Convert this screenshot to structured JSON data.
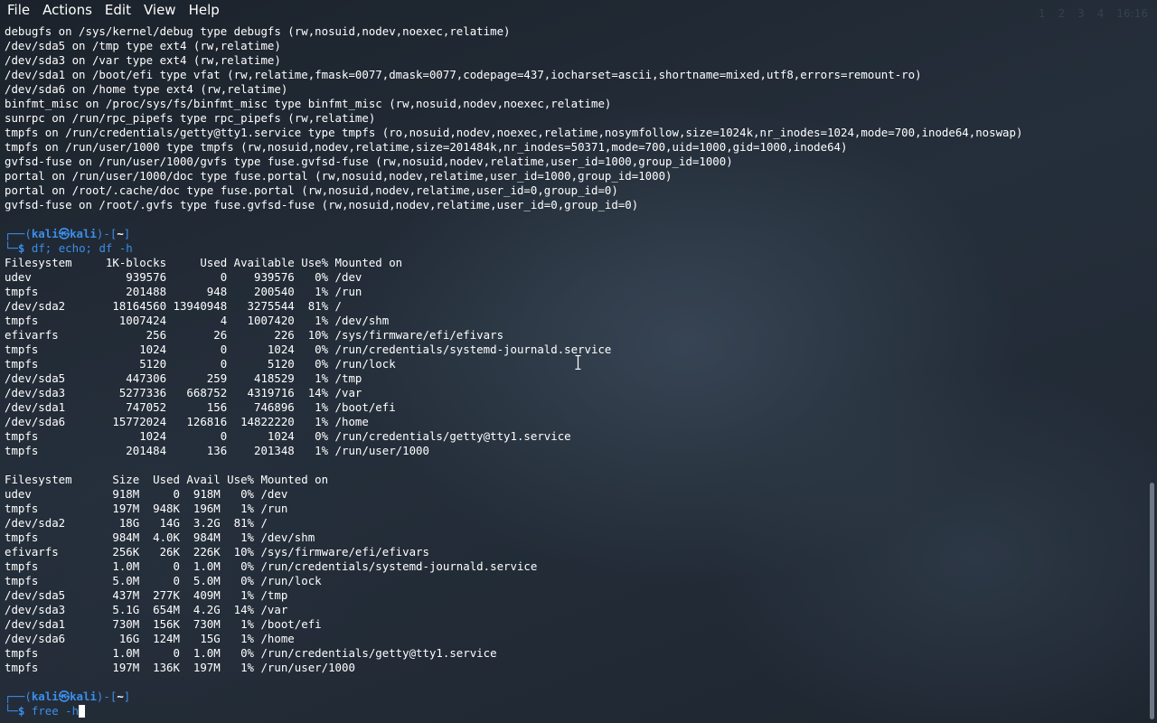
{
  "menubar": {
    "items": [
      "File",
      "Actions",
      "Edit",
      "View",
      "Help"
    ]
  },
  "tray": {
    "clock": "16:16",
    "workspaces": [
      "1",
      "2",
      "3",
      "4"
    ]
  },
  "terminal": {
    "mount_output": [
      "debugfs on /sys/kernel/debug type debugfs (rw,nosuid,nodev,noexec,relatime)",
      "/dev/sda5 on /tmp type ext4 (rw,relatime)",
      "/dev/sda3 on /var type ext4 (rw,relatime)",
      "/dev/sda1 on /boot/efi type vfat (rw,relatime,fmask=0077,dmask=0077,codepage=437,iocharset=ascii,shortname=mixed,utf8,errors=remount-ro)",
      "/dev/sda6 on /home type ext4 (rw,relatime)",
      "binfmt_misc on /proc/sys/fs/binfmt_misc type binfmt_misc (rw,nosuid,nodev,noexec,relatime)",
      "sunrpc on /run/rpc_pipefs type rpc_pipefs (rw,relatime)",
      "tmpfs on /run/credentials/getty@tty1.service type tmpfs (ro,nosuid,nodev,noexec,relatime,nosymfollow,size=1024k,nr_inodes=1024,mode=700,inode64,noswap)",
      "tmpfs on /run/user/1000 type tmpfs (rw,nosuid,nodev,relatime,size=201484k,nr_inodes=50371,mode=700,uid=1000,gid=1000,inode64)",
      "gvfsd-fuse on /run/user/1000/gvfs type fuse.gvfsd-fuse (rw,nosuid,nodev,relatime,user_id=1000,group_id=1000)",
      "portal on /run/user/1000/doc type fuse.portal (rw,nosuid,nodev,relatime,user_id=1000,group_id=1000)",
      "portal on /root/.cache/doc type fuse.portal (rw,nosuid,nodev,relatime,user_id=0,group_id=0)",
      "gvfsd-fuse on /root/.gvfs type fuse.gvfsd-fuse (rw,nosuid,nodev,relatime,user_id=0,group_id=0)"
    ],
    "prompt": {
      "top_left": "┌──(",
      "user": "kali",
      "at": "㉿",
      "host": "kali",
      "mid": ")-[",
      "path": "~",
      "close": "]",
      "bottom": "└─",
      "dollar": "$"
    },
    "command_1": "df; echo; df -h",
    "df_output": [
      "Filesystem     1K-blocks     Used Available Use% Mounted on",
      "udev              939576        0    939576   0% /dev",
      "tmpfs             201488      948    200540   1% /run",
      "/dev/sda2       18164560 13940948   3275544  81% /",
      "tmpfs            1007424        4   1007420   1% /dev/shm",
      "efivarfs             256       26       226  10% /sys/firmware/efi/efivars",
      "tmpfs               1024        0      1024   0% /run/credentials/systemd-journald.service",
      "tmpfs               5120        0      5120   0% /run/lock",
      "/dev/sda5         447306      259    418529   1% /tmp",
      "/dev/sda3        5277336   668752   4319716  14% /var",
      "/dev/sda1         747052      156    746896   1% /boot/efi",
      "/dev/sda6       15772024   126816  14822220   1% /home",
      "tmpfs               1024        0      1024   0% /run/credentials/getty@tty1.service",
      "tmpfs             201484      136    201348   1% /run/user/1000"
    ],
    "df_h_output": [
      "Filesystem      Size  Used Avail Use% Mounted on",
      "udev            918M     0  918M   0% /dev",
      "tmpfs           197M  948K  196M   1% /run",
      "/dev/sda2        18G   14G  3.2G  81% /",
      "tmpfs           984M  4.0K  984M   1% /dev/shm",
      "efivarfs        256K   26K  226K  10% /sys/firmware/efi/efivars",
      "tmpfs           1.0M     0  1.0M   0% /run/credentials/systemd-journald.service",
      "tmpfs           5.0M     0  5.0M   0% /run/lock",
      "/dev/sda5       437M  277K  409M   1% /tmp",
      "/dev/sda3       5.1G  654M  4.2G  14% /var",
      "/dev/sda1       730M  156K  730M   1% /boot/efi",
      "/dev/sda6        16G  124M   15G   1% /home",
      "tmpfs           1.0M     0  1.0M   0% /run/credentials/getty@tty1.service",
      "tmpfs           197M  136K  197M   1% /run/user/1000"
    ],
    "command_2_typed": "free -",
    "command_2_under_cursor": "h"
  },
  "colors": {
    "background": "#1c232d",
    "text": "#ffffff",
    "prompt_accent": "#3b8eea"
  }
}
